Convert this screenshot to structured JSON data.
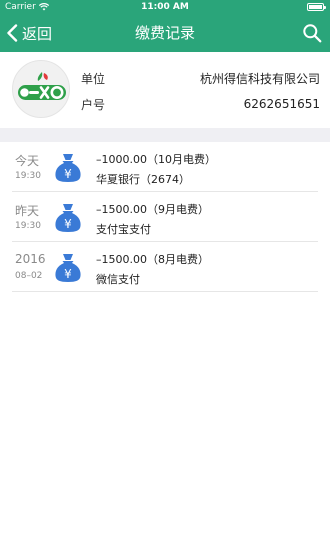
{
  "status_bar": {
    "carrier": "Carrier",
    "time": "11:00 AM",
    "wifi_icon": "wifi-icon",
    "battery_icon": "battery-icon"
  },
  "nav": {
    "back_label": "返回",
    "title": "缴费记录",
    "search_icon": "search-icon",
    "back_icon": "chevron-left-icon",
    "color": "#2aa57a"
  },
  "account": {
    "logo_icon": "utility-logo",
    "unit_label": "单位",
    "unit_value": "杭州得信科技有限公司",
    "account_label": "户号",
    "account_value": "6262651651"
  },
  "records": [
    {
      "date_main": "今天",
      "date_sub": "19:30",
      "amount": "–1000.00（10月电费）",
      "source": "华夏银行（2674）",
      "icon": "money-bag-icon"
    },
    {
      "date_main": "昨天",
      "date_sub": "19:30",
      "amount": "–1500.00（9月电费）",
      "source": "支付宝支付",
      "icon": "money-bag-icon"
    },
    {
      "date_main": "2016",
      "date_sub": "08–02",
      "amount": "–1500.00（8月电费）",
      "source": "微信支付",
      "icon": "money-bag-icon"
    }
  ],
  "colors": {
    "accent": "#2aa57a",
    "bag": "#3a7ad6",
    "band": "#efeff3"
  }
}
